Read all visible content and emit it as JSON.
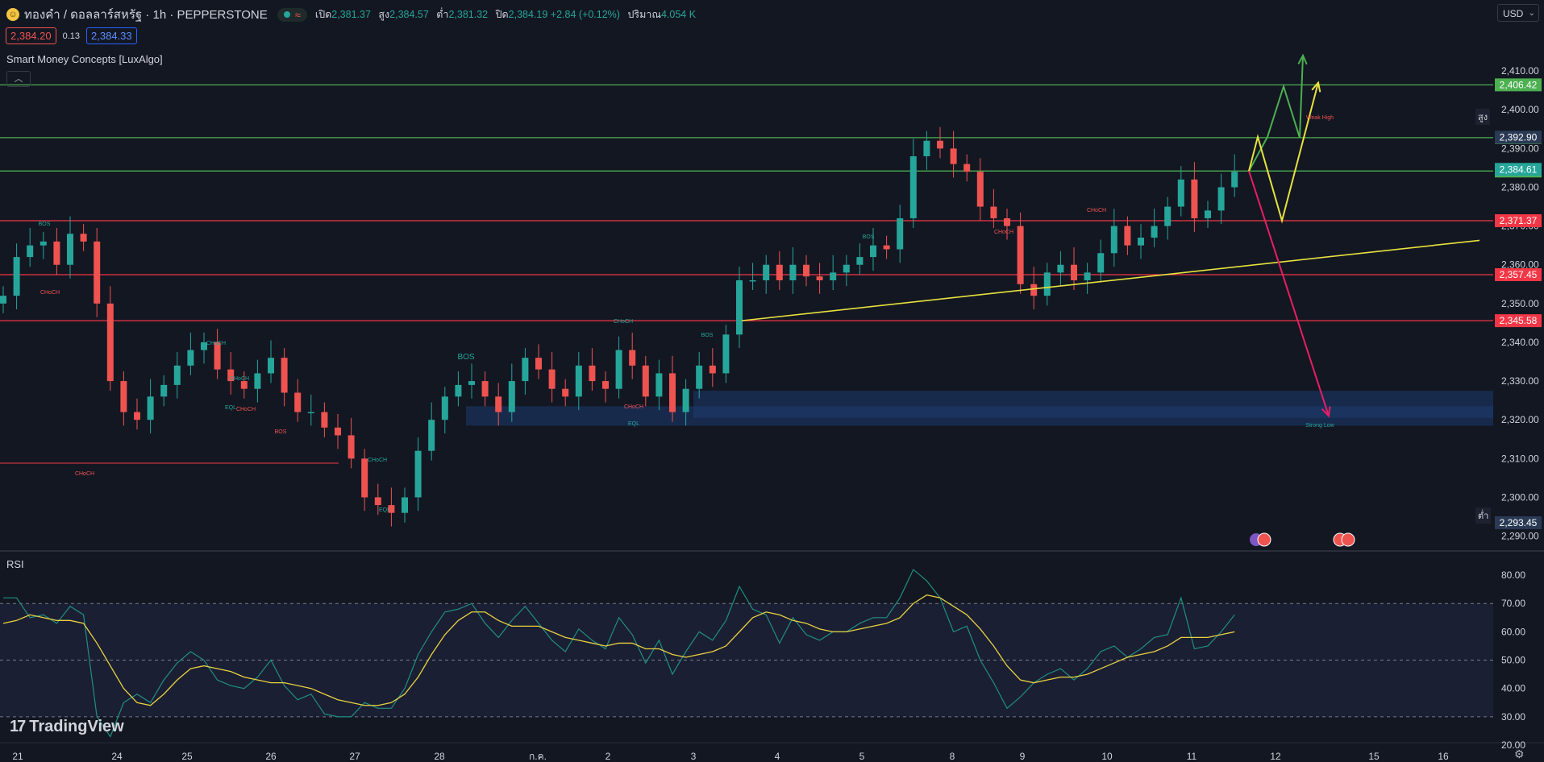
{
  "header": {
    "symbol_icon": "coin-face-icon",
    "title": "ทองคำ / ดอลลาร์สหรัฐ · 1h · PEPPERSTONE",
    "market_status_icon": "market-open-dot-icon",
    "wave_icon": "wave-icon",
    "ohlc": [
      {
        "label": "เปิด",
        "value": "2,381.37"
      },
      {
        "label": "สูง",
        "value": "2,384.57"
      },
      {
        "label": "ต่ำ",
        "value": "2,381.32"
      },
      {
        "label": "ปิด",
        "value": "2,384.19 +2.84 (+0.12%)"
      },
      {
        "label": "ปริมาณ",
        "value": "4.054 K"
      }
    ]
  },
  "trade": {
    "sell": "2,384.20",
    "spread": "0.13",
    "buy": "2,384.33"
  },
  "indicator": {
    "name": "Smart Money Concepts [LuxAlgo]",
    "collapse_icon": "chevron-up-icon"
  },
  "currency": {
    "value": "USD",
    "icon": "chevron-down-icon"
  },
  "rsi": {
    "name": "RSI"
  },
  "branding": {
    "name": "TradingView",
    "icon": "tradingview-logo-icon"
  },
  "footer": {
    "settings_icon": "settings-gear-icon"
  },
  "colors": {
    "background": "#131722",
    "bull": "#26a69a",
    "bear": "#ef5350",
    "green_line": "#4caf50",
    "red_line": "#f23645",
    "yellow": "#e8e23f",
    "zone": "#1e3a70",
    "rsi_line": "#1f8f80",
    "rsi_ma": "#e8d23f"
  },
  "chart_data": [
    {
      "type": "candlestick",
      "price_axis": {
        "ticks": [
          "2,410.00",
          "2,400.00",
          "2,390.00",
          "2,380.00",
          "2,370.00",
          "2,360.00",
          "2,350.00",
          "2,340.00",
          "2,330.00",
          "2,320.00",
          "2,310.00",
          "2,300.00",
          "2,290.00"
        ],
        "range": [
          2287,
          2420
        ]
      },
      "time_axis": {
        "labels": [
          "21",
          "24",
          "25",
          "26",
          "27",
          "28",
          "ก.ค.",
          "2",
          "3",
          "4",
          "5",
          "8",
          "9",
          "10",
          "11",
          "12",
          "15",
          "16"
        ]
      },
      "horizontal_levels": [
        {
          "price": 2406.42,
          "color": "green",
          "label": "2,406.42"
        },
        {
          "price": 2392.81,
          "color": "green",
          "label": "2,392.81"
        },
        {
          "price": 2384.19,
          "color": "green",
          "label": "2,384.19"
        },
        {
          "price": 2371.37,
          "color": "red",
          "label": "2,371.37"
        },
        {
          "price": 2357.45,
          "color": "red",
          "label": "2,357.45"
        },
        {
          "price": 2345.58,
          "color": "red",
          "label": "2,345.58"
        }
      ],
      "axis_tags": [
        {
          "price": 2384.61,
          "label": "2,384.61"
        },
        {
          "price": 2392.9,
          "label": "2,392.90",
          "caption": "สูง"
        },
        {
          "price": 2293.45,
          "label": "2,293.45",
          "caption": "ต่ำ"
        }
      ],
      "annotations": [
        "BOS",
        "CHoCH",
        "CHoCH",
        "CHoCH",
        "EQL",
        "CHoCH",
        "BOS",
        "CHoCH",
        "EQL",
        "CHoCH",
        "BOS",
        "CHoCH",
        "CHoCH",
        "BOS",
        "EQL",
        "CHoCH",
        "BOS",
        "CHoCH",
        "Weak High",
        "Strong Low"
      ],
      "series": [
        {
          "name": "price",
          "close": [
            2352,
            2362,
            2365,
            2366,
            2360,
            2368,
            2366,
            2350,
            2330,
            2322,
            2320,
            2326,
            2329,
            2334,
            2338,
            2340,
            2333,
            2330,
            2328,
            2332,
            2336,
            2327,
            2322,
            2322,
            2318,
            2316,
            2310,
            2300,
            2298,
            2296,
            2300,
            2312,
            2320,
            2326,
            2329,
            2330,
            2326,
            2322,
            2330,
            2336,
            2333,
            2328,
            2326,
            2334,
            2330,
            2328,
            2338,
            2334,
            2326,
            2332,
            2322,
            2328,
            2334,
            2332,
            2342,
            2356,
            2356,
            2360,
            2356,
            2360,
            2357,
            2356,
            2358,
            2360,
            2362,
            2365,
            2364,
            2372,
            2388,
            2392,
            2390,
            2386,
            2384,
            2375,
            2372,
            2370,
            2355,
            2352,
            2358,
            2360,
            2356,
            2358,
            2363,
            2370,
            2365,
            2367,
            2370,
            2375,
            2382,
            2372,
            2374,
            2380,
            2384
          ]
        },
        {
          "name": "projection-green",
          "points": [
            2384.19,
            2393,
            2406,
            2392.8,
            2414
          ]
        },
        {
          "name": "projection-yellow",
          "points": [
            2384.19,
            2393,
            2371.37,
            2407
          ]
        },
        {
          "name": "projection-red",
          "points": [
            2384.19,
            2321
          ]
        }
      ]
    },
    {
      "type": "line",
      "name": "RSI",
      "y_axis": {
        "ticks": [
          "80.00",
          "70.00",
          "60.00",
          "50.00",
          "40.00",
          "30.00",
          "20.00"
        ],
        "range": [
          20,
          84
        ]
      },
      "bands": [
        70,
        50,
        30
      ],
      "series": [
        {
          "name": "rsi",
          "values": [
            72,
            72,
            65,
            66,
            63,
            69,
            66,
            30,
            23,
            35,
            38,
            35,
            43,
            49,
            53,
            50,
            43,
            41,
            40,
            44,
            50,
            41,
            36,
            38,
            31,
            30,
            30,
            35,
            33,
            33,
            40,
            52,
            60,
            67,
            68,
            70,
            63,
            58,
            64,
            69,
            63,
            57,
            53,
            61,
            57,
            54,
            65,
            59,
            49,
            57,
            45,
            53,
            60,
            57,
            64,
            76,
            68,
            66,
            56,
            65,
            59,
            57,
            60,
            60,
            63,
            65,
            65,
            72,
            82,
            78,
            72,
            60,
            62,
            50,
            42,
            33,
            37,
            42,
            45,
            47,
            43,
            47,
            53,
            55,
            51,
            54,
            58,
            59,
            72,
            54,
            55,
            60,
            66
          ]
        },
        {
          "name": "rsi-ma",
          "values": [
            63,
            64,
            66,
            65,
            64,
            64,
            63,
            56,
            48,
            40,
            35,
            34,
            38,
            43,
            47,
            48,
            47,
            46,
            44,
            43,
            42,
            42,
            41,
            40,
            38,
            36,
            35,
            34,
            34,
            35,
            38,
            44,
            52,
            59,
            64,
            67,
            67,
            64,
            62,
            62,
            62,
            60,
            58,
            57,
            56,
            55,
            56,
            56,
            54,
            54,
            52,
            51,
            52,
            53,
            55,
            60,
            65,
            67,
            66,
            64,
            63,
            61,
            60,
            60,
            61,
            62,
            63,
            65,
            70,
            73,
            72,
            69,
            66,
            61,
            55,
            48,
            43,
            42,
            43,
            44,
            44,
            45,
            47,
            49,
            51,
            52,
            53,
            55,
            58,
            58,
            58,
            59,
            60
          ]
        }
      ]
    }
  ]
}
